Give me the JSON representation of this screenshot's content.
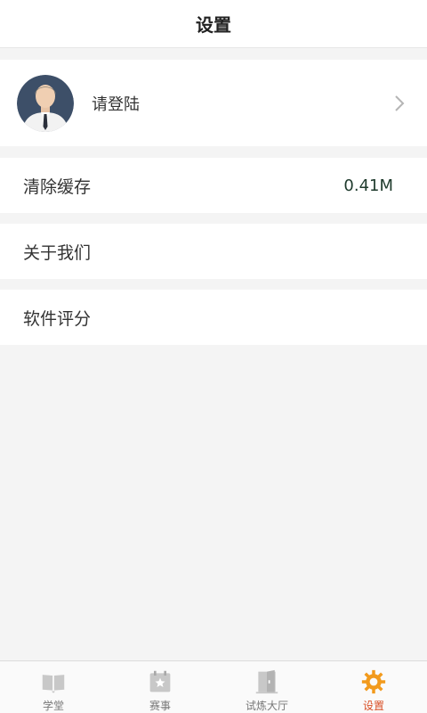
{
  "header": {
    "title": "设置"
  },
  "profile": {
    "login_label": "请登陆"
  },
  "settings": {
    "clear_cache": {
      "label": "清除缓存",
      "value": "0.41M"
    },
    "about": {
      "label": "关于我们"
    },
    "rate": {
      "label": "软件评分"
    }
  },
  "tabbar": {
    "tabs": [
      {
        "label": "学堂",
        "icon": "book-icon"
      },
      {
        "label": "赛事",
        "icon": "calendar-star-icon"
      },
      {
        "label": "试炼大厅",
        "icon": "door-icon"
      },
      {
        "label": "设置",
        "icon": "gear-icon"
      }
    ],
    "active_index": 3,
    "active_color": "#f29a1c"
  }
}
